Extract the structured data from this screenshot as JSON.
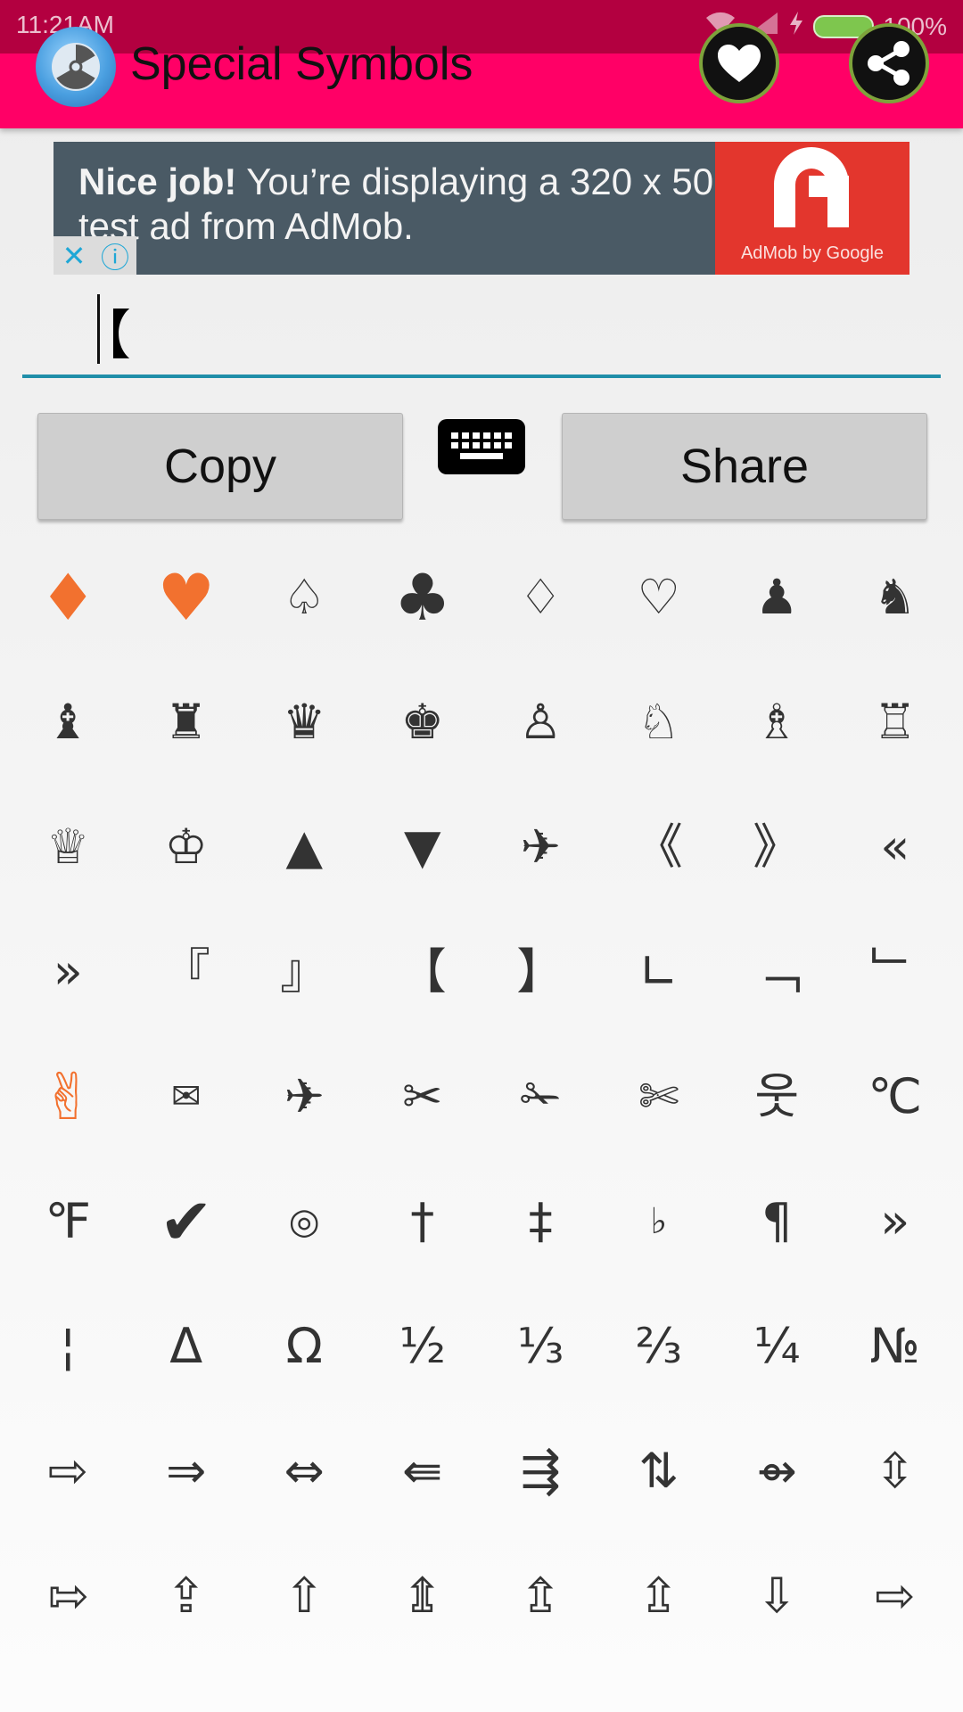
{
  "status": {
    "time": "11:21AM",
    "battery": "100%"
  },
  "app": {
    "title": "Special Symbols",
    "accent": "#ff0066"
  },
  "ad": {
    "bold": "Nice job!",
    "text": " You’re displaying a 320 x 50 test ad from AdMob.",
    "brand": "AdMob by Google"
  },
  "input": {
    "value": "【"
  },
  "buttons": {
    "copy": "Copy",
    "share": "Share"
  },
  "symbols": [
    "♦",
    "♥",
    "♤",
    "♣",
    "♢",
    "♡",
    "♟",
    "♞",
    "♝",
    "♜",
    "♛",
    "♚",
    "♙",
    "♘",
    "♗",
    "♖",
    "♕",
    "♔",
    "▲",
    "▼",
    "✈",
    "《",
    "》",
    "«",
    "»",
    "『",
    "』",
    "【",
    "】",
    "∟",
    "﹁",
    "﹂",
    "✌",
    "✉",
    "✈",
    "✂",
    "✁",
    "✄",
    "웃",
    "℃",
    "℉",
    "✔",
    "◎",
    "†",
    "‡",
    "♭",
    "¶",
    "»",
    "¦",
    "Δ",
    "Ω",
    "½",
    "⅓",
    "⅔",
    "¼",
    "№",
    "⇨",
    "⇒",
    "⇔",
    "⇚",
    "⇶",
    "⇅",
    "⇴",
    "⇳",
    "⇰",
    "⇪",
    "⇧",
    "⇭",
    "⇬",
    "⇫",
    "⇩",
    "⇨"
  ]
}
